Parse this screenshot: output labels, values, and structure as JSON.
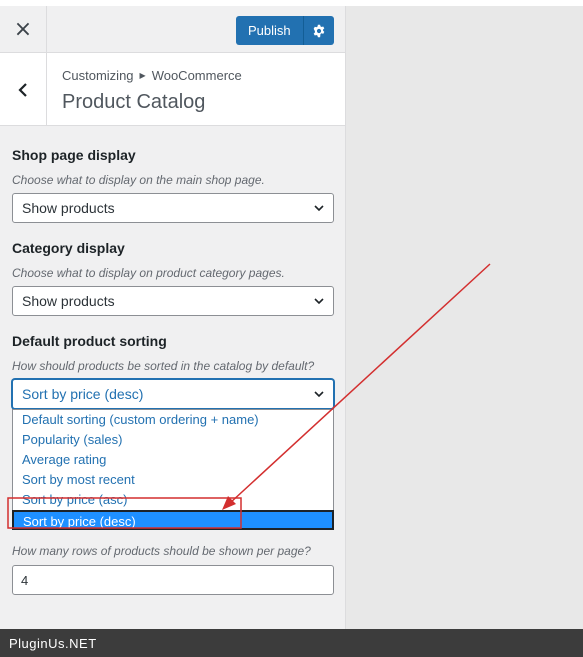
{
  "topbar": {
    "close_icon": "×",
    "publish_label": "Publish",
    "gear": "gear-icon"
  },
  "header": {
    "breadcrumb_root": "Customizing",
    "breadcrumb_child": "WooCommerce",
    "title": "Product Catalog"
  },
  "shop_display": {
    "title": "Shop page display",
    "desc": "Choose what to display on the main shop page.",
    "value": "Show products"
  },
  "category_display": {
    "title": "Category display",
    "desc": "Choose what to display on product category pages.",
    "value": "Show products"
  },
  "sorting": {
    "title": "Default product sorting",
    "desc": "How should products be sorted in the catalog by default?",
    "value": "Sort by price (desc)",
    "options": [
      "Default sorting (custom ordering + name)",
      "Popularity (sales)",
      "Average rating",
      "Sort by most recent",
      "Sort by price (asc)",
      "Sort by price (desc)"
    ]
  },
  "rows": {
    "desc": "How many rows of products should be shown per page?",
    "value": "4"
  },
  "footer": {
    "text": "PluginUs.NET"
  },
  "colors": {
    "accent": "#2271b1",
    "selected": "#1e90ff",
    "annotation": "#d32f2f"
  }
}
